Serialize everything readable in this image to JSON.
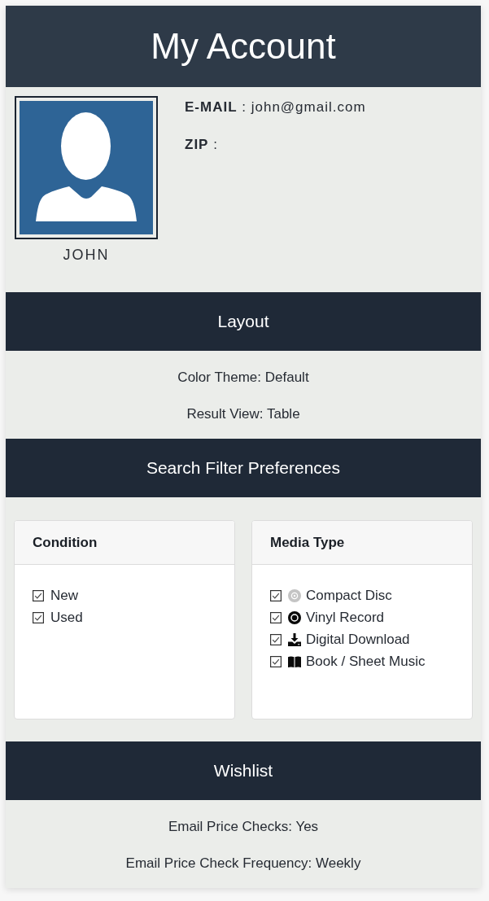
{
  "header": {
    "title": "My Account"
  },
  "profile": {
    "name": "JOHN",
    "lines": [
      "**E-MAIL** : john@gmail.com",
      "**ZIP** :"
    ]
  },
  "sections": [
    {
      "kind": "settings",
      "title": "Layout",
      "lines": [
        "Color Theme: Default",
        "Result View: Table"
      ]
    },
    {
      "kind": "filters",
      "title": "Search Filter Preferences",
      "groups": [
        {
          "title": "Condition",
          "options": [
            {
              "label": "New",
              "checked": true
            },
            {
              "label": "Used",
              "checked": true
            }
          ]
        },
        {
          "title": "Media Type",
          "options": [
            {
              "kind": "disc",
              "label": "Compact Disc",
              "checked": true
            },
            {
              "kind": "vinyl",
              "label": "Vinyl Record",
              "checked": true
            },
            {
              "kind": "download",
              "label": "Digital Download",
              "checked": true
            },
            {
              "kind": "book",
              "label": "Book / Sheet Music",
              "checked": true
            }
          ]
        }
      ]
    },
    {
      "kind": "settings",
      "title": "Wishlist",
      "lines": [
        "Email Price Checks: Yes",
        "Email Price Check Frequency: Weekly"
      ]
    }
  ]
}
